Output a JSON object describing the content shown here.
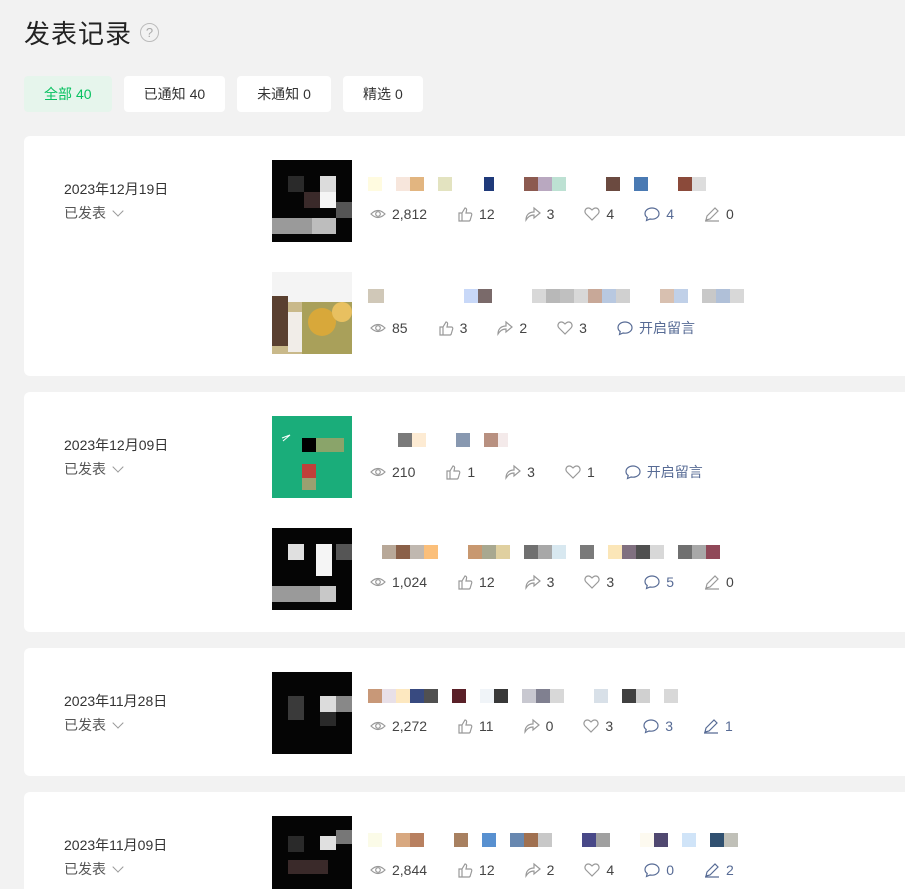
{
  "page": {
    "title": "发表记录",
    "help_icon": "?"
  },
  "tabs": [
    {
      "label": "全部",
      "count": "40"
    },
    {
      "label": "已通知",
      "count": "40"
    },
    {
      "label": "未通知",
      "count": "0"
    },
    {
      "label": "精选",
      "count": "0"
    }
  ],
  "status_label": "已发表",
  "groups": [
    {
      "date": "2023年12月19日",
      "articles": [
        {
          "views": "2,812",
          "likes": "12",
          "shares": "3",
          "wows": "4",
          "comments": "4",
          "comments_enabled": true,
          "edits": "0"
        },
        {
          "views": "85",
          "likes": "3",
          "shares": "2",
          "wows": "3",
          "comments": "开启留言",
          "comments_enabled": false,
          "edits": ""
        }
      ]
    },
    {
      "date": "2023年12月09日",
      "articles": [
        {
          "views": "210",
          "likes": "1",
          "shares": "3",
          "wows": "1",
          "comments": "开启留言",
          "comments_enabled": false,
          "edits": ""
        },
        {
          "views": "1,024",
          "likes": "12",
          "shares": "3",
          "wows": "3",
          "comments": "5",
          "comments_enabled": true,
          "edits": "0"
        }
      ]
    },
    {
      "date": "2023年11月28日",
      "articles": [
        {
          "views": "2,272",
          "likes": "11",
          "shares": "0",
          "wows": "3",
          "comments": "3",
          "comments_enabled": true,
          "edits": "1"
        }
      ]
    },
    {
      "date": "2023年11月09日",
      "articles": [
        {
          "views": "2,844",
          "likes": "12",
          "shares": "2",
          "wows": "4",
          "comments": "0",
          "comments_enabled": true,
          "edits": "2"
        }
      ]
    }
  ],
  "colors": {
    "accent": "#07c160",
    "accent_bg": "#e6f5ec",
    "link": "#576b95"
  },
  "icons": [
    "help-icon",
    "chevron-down-icon",
    "eye-icon",
    "thumbs-up-icon",
    "share-icon",
    "heart-icon",
    "comment-icon",
    "pen-icon"
  ]
}
